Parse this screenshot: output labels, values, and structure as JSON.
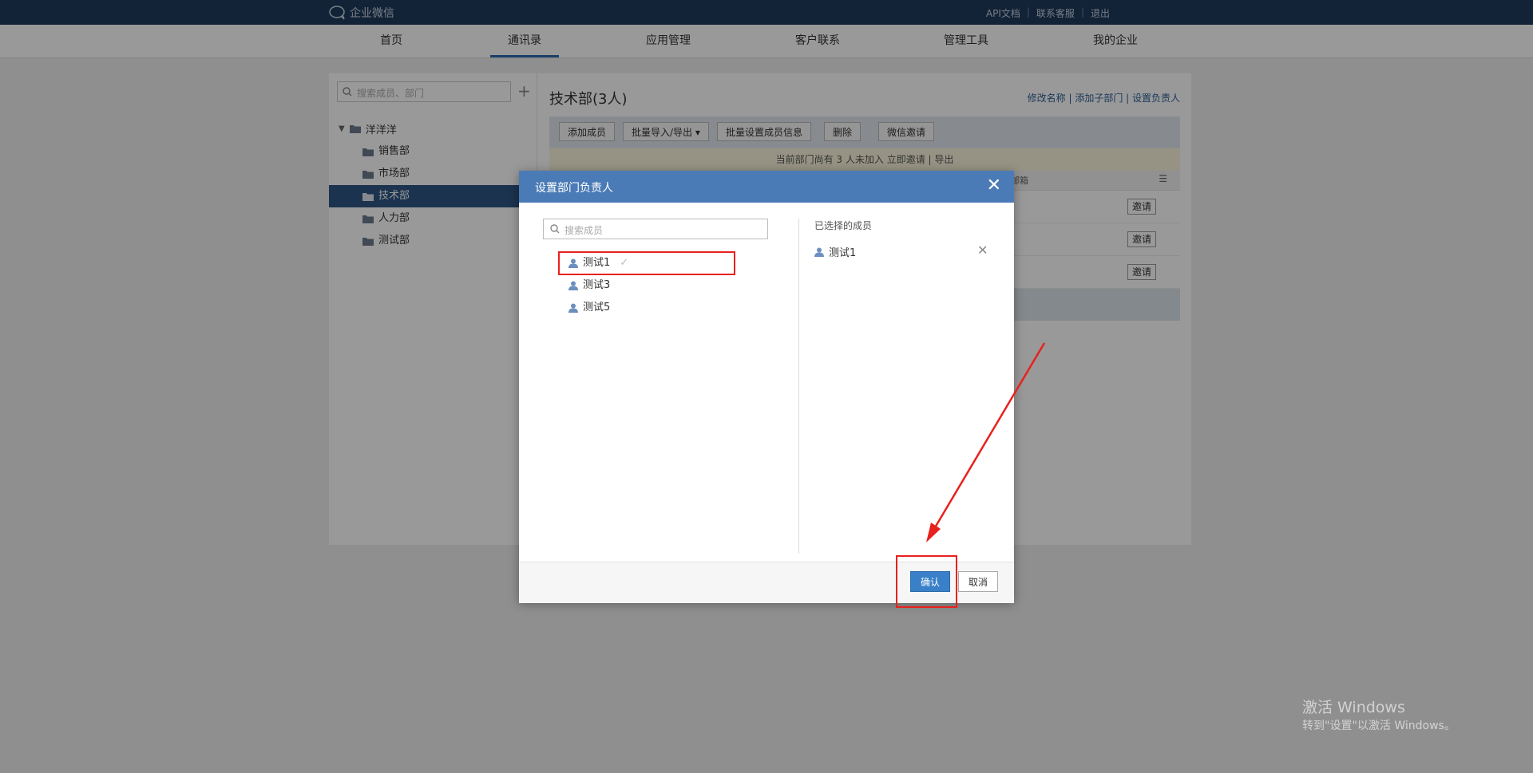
{
  "app": {
    "name": "企业微信"
  },
  "top_links": [
    "API文档",
    "联系客服",
    "退出"
  ],
  "nav": [
    "首页",
    "通讯录",
    "应用管理",
    "客户联系",
    "管理工具",
    "我的企业"
  ],
  "sidebar": {
    "search_placeholder": "搜索成员、部门",
    "root": "洋洋洋",
    "items": [
      "销售部",
      "市场部",
      "技术部",
      "人力部",
      "测试部"
    ]
  },
  "dept": {
    "title": "技术部(3人)",
    "actions": "修改名称 | 添加子部门 | 设置负责人",
    "toolbar": [
      "添加成员",
      "批量导入/导出 ▾",
      "批量设置成员信息",
      "删除",
      "微信邀请"
    ],
    "notice": "当前部门尚有 3 人未加入   立即邀请 | 导出",
    "header_partial": "邮箱",
    "invite_label": "邀请"
  },
  "dialog": {
    "title": "设置部门负责人",
    "search_placeholder": "搜索成员",
    "members": [
      "测试1",
      "测试3",
      "测试5"
    ],
    "selected_title": "已选择的成员",
    "selected": [
      "测试1"
    ],
    "ok_label": "确认",
    "cancel_label": "取消"
  },
  "watermark": {
    "line1": "激活 Windows",
    "line2": "转到\"设置\"以激活 Windows。"
  },
  "colors": {
    "accent": "#4b7bb6",
    "highlight": "#e8211e",
    "topbar": "#1f3a5c"
  }
}
